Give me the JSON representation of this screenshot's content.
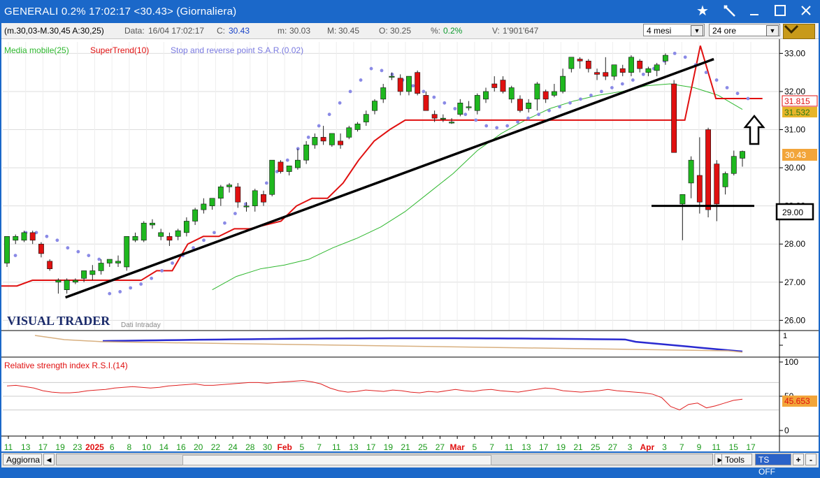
{
  "window": {
    "title": "GENERALI 0.2% 17:02:17  <30.43> (Giornaliera)",
    "star_icon": "star-icon",
    "pin_icon": "pin-icon",
    "minimize_icon": "minimize-icon",
    "maximize_icon": "maximize-icon",
    "close_icon": "close-icon"
  },
  "infobar": {
    "range": "(m.30,03-M.30,45 A:30,25)",
    "date_label": "Data:",
    "date_value": "16/04 17:02:17",
    "close_label": "C:",
    "close_value": "30.43",
    "min_label": "m:",
    "min_value": "30.03",
    "max_label": "M:",
    "max_value": "30.45",
    "open_label": "O:",
    "open_value": "30.25",
    "pct_label": "%:",
    "pct_value": "0.2%",
    "vol_label": "V:",
    "vol_value": "1'901'647",
    "period_select": "4 mesi",
    "interval_select": "24 ore"
  },
  "legend": {
    "ma": "Media mobile(25)",
    "supertrend": "SuperTrend(10)",
    "sar": "Stop and reverse point S.A.R.(0.02)"
  },
  "watermark": {
    "brand": "VISUAL TRADER",
    "subtitle": "Dati Intraday"
  },
  "rsi_panel": {
    "title": "Relative strength index R.S.I.(14)"
  },
  "osc_panel": {
    "top_label": "1"
  },
  "price_tags": {
    "sar_value": "31.815",
    "ma_value": "31.532",
    "last_value": "30.43",
    "level_value": "29.00",
    "rsi_value": "45.653"
  },
  "bottombar": {
    "update_button": "Aggiorna",
    "tools_button": "Tools",
    "ts_button": "TS OFF",
    "plus_button": "+",
    "minus_button": "-"
  },
  "colors": {
    "up_candle": "#1fb81f",
    "down_candle": "#e01010",
    "ma": "#2fb82f",
    "supertrend": "#e01010",
    "sar": "#8a8ae6",
    "rsi": "#e02020",
    "axis_dates_red": "#e01010",
    "axis_dates_green": "#1a9a1a"
  },
  "chart_data": {
    "type": "candlestick",
    "title": "GENERALI (Giornaliera)",
    "price_axis": {
      "ticks": [
        26.0,
        27.0,
        28.0,
        29.0,
        30.0,
        31.0,
        32.0,
        33.0
      ],
      "ylim": [
        25.75,
        33.3
      ]
    },
    "rsi_axis": {
      "ticks": [
        0,
        50,
        100
      ]
    },
    "x_labels": [
      "11",
      "13",
      "17",
      "19",
      "23",
      "2025",
      "6",
      "8",
      "10",
      "14",
      "16",
      "20",
      "22",
      "24",
      "28",
      "30",
      "Feb",
      "5",
      "7",
      "11",
      "13",
      "17",
      "19",
      "21",
      "25",
      "27",
      "Mar",
      "5",
      "7",
      "11",
      "13",
      "17",
      "19",
      "21",
      "25",
      "27",
      "3",
      "Apr",
      "3",
      "7",
      "9",
      "11",
      "15",
      "17"
    ],
    "candles": [
      {
        "o": 27.5,
        "h": 28.2,
        "l": 27.4,
        "c": 28.2
      },
      {
        "o": 28.1,
        "h": 28.25,
        "l": 28.0,
        "c": 28.2
      },
      {
        "o": 28.1,
        "h": 28.35,
        "l": 28.05,
        "c": 28.3
      },
      {
        "o": 28.3,
        "h": 28.35,
        "l": 28.0,
        "c": 28.1
      },
      {
        "o": 28.0,
        "h": 28.05,
        "l": 27.65,
        "c": 27.75
      },
      {
        "o": 27.55,
        "h": 27.6,
        "l": 27.3,
        "c": 27.35
      },
      {
        "o": 27.0,
        "h": 27.1,
        "l": 26.7,
        "c": 27.05
      },
      {
        "o": 26.8,
        "h": 27.1,
        "l": 26.7,
        "c": 27.05
      },
      {
        "o": 27.0,
        "h": 27.1,
        "l": 26.95,
        "c": 27.05
      },
      {
        "o": 27.1,
        "h": 27.3,
        "l": 27.0,
        "c": 27.3
      },
      {
        "o": 27.2,
        "h": 27.45,
        "l": 27.05,
        "c": 27.3
      },
      {
        "o": 27.3,
        "h": 27.6,
        "l": 27.2,
        "c": 27.5
      },
      {
        "o": 27.5,
        "h": 27.6,
        "l": 27.4,
        "c": 27.6
      },
      {
        "o": 27.5,
        "h": 27.7,
        "l": 27.4,
        "c": 27.55
      },
      {
        "o": 27.4,
        "h": 28.2,
        "l": 27.3,
        "c": 28.2
      },
      {
        "o": 28.1,
        "h": 28.3,
        "l": 28.05,
        "c": 28.2
      },
      {
        "o": 28.1,
        "h": 28.6,
        "l": 28.05,
        "c": 28.55
      },
      {
        "o": 28.5,
        "h": 28.65,
        "l": 28.4,
        "c": 28.55
      },
      {
        "o": 28.2,
        "h": 28.4,
        "l": 28.1,
        "c": 28.3
      },
      {
        "o": 28.2,
        "h": 28.3,
        "l": 27.95,
        "c": 28.1
      },
      {
        "o": 28.2,
        "h": 28.4,
        "l": 28.1,
        "c": 28.35
      },
      {
        "o": 28.3,
        "h": 28.7,
        "l": 28.2,
        "c": 28.6
      },
      {
        "o": 28.6,
        "h": 28.95,
        "l": 28.5,
        "c": 28.9
      },
      {
        "o": 28.9,
        "h": 29.2,
        "l": 28.8,
        "c": 29.05
      },
      {
        "o": 29.0,
        "h": 29.2,
        "l": 28.9,
        "c": 29.2
      },
      {
        "o": 29.2,
        "h": 29.55,
        "l": 29.0,
        "c": 29.5
      },
      {
        "o": 29.5,
        "h": 29.6,
        "l": 29.35,
        "c": 29.55
      },
      {
        "o": 29.5,
        "h": 29.6,
        "l": 28.95,
        "c": 29.1
      },
      {
        "o": 29.0,
        "h": 29.1,
        "l": 28.85,
        "c": 29.0
      },
      {
        "o": 29.0,
        "h": 29.45,
        "l": 28.85,
        "c": 29.4
      },
      {
        "o": 29.3,
        "h": 29.4,
        "l": 29.0,
        "c": 29.1
      },
      {
        "o": 29.3,
        "h": 30.2,
        "l": 29.25,
        "c": 30.2
      },
      {
        "o": 30.15,
        "h": 30.2,
        "l": 29.85,
        "c": 29.9
      },
      {
        "o": 29.9,
        "h": 30.05,
        "l": 29.8,
        "c": 30.05
      },
      {
        "o": 30.0,
        "h": 30.5,
        "l": 29.95,
        "c": 30.2
      },
      {
        "o": 30.2,
        "h": 30.7,
        "l": 30.1,
        "c": 30.6
      },
      {
        "o": 30.6,
        "h": 30.9,
        "l": 30.5,
        "c": 30.8
      },
      {
        "o": 30.8,
        "h": 31.1,
        "l": 30.6,
        "c": 30.7
      },
      {
        "o": 30.6,
        "h": 30.9,
        "l": 30.55,
        "c": 30.9
      },
      {
        "o": 30.7,
        "h": 30.9,
        "l": 30.5,
        "c": 30.6
      },
      {
        "o": 30.8,
        "h": 31.1,
        "l": 30.75,
        "c": 31.05
      },
      {
        "o": 31.0,
        "h": 31.2,
        "l": 30.95,
        "c": 31.15
      },
      {
        "o": 31.2,
        "h": 31.5,
        "l": 31.1,
        "c": 31.4
      },
      {
        "o": 31.5,
        "h": 31.8,
        "l": 31.4,
        "c": 31.75
      },
      {
        "o": 31.8,
        "h": 32.2,
        "l": 31.7,
        "c": 32.1
      },
      {
        "o": 32.4,
        "h": 32.5,
        "l": 32.3,
        "c": 32.4
      },
      {
        "o": 32.35,
        "h": 32.45,
        "l": 31.9,
        "c": 32.0
      },
      {
        "o": 32.0,
        "h": 32.4,
        "l": 31.9,
        "c": 32.4
      },
      {
        "o": 32.5,
        "h": 32.55,
        "l": 31.9,
        "c": 31.95
      },
      {
        "o": 31.9,
        "h": 32.0,
        "l": 31.5,
        "c": 31.5
      },
      {
        "o": 31.4,
        "h": 31.5,
        "l": 31.2,
        "c": 31.3
      },
      {
        "o": 31.3,
        "h": 31.4,
        "l": 31.2,
        "c": 31.3
      },
      {
        "o": 31.2,
        "h": 31.3,
        "l": 31.15,
        "c": 31.2
      },
      {
        "o": 31.4,
        "h": 31.8,
        "l": 31.35,
        "c": 31.7
      },
      {
        "o": 31.6,
        "h": 31.75,
        "l": 31.5,
        "c": 31.6
      },
      {
        "o": 31.5,
        "h": 31.95,
        "l": 31.4,
        "c": 31.9
      },
      {
        "o": 31.8,
        "h": 32.1,
        "l": 31.7,
        "c": 32.0
      },
      {
        "o": 32.2,
        "h": 32.4,
        "l": 32.0,
        "c": 32.1
      },
      {
        "o": 32.3,
        "h": 32.4,
        "l": 31.95,
        "c": 32.0
      },
      {
        "o": 31.8,
        "h": 32.15,
        "l": 31.7,
        "c": 32.1
      },
      {
        "o": 31.8,
        "h": 31.9,
        "l": 31.45,
        "c": 31.5
      },
      {
        "o": 31.55,
        "h": 31.8,
        "l": 31.45,
        "c": 31.7
      },
      {
        "o": 31.8,
        "h": 32.25,
        "l": 31.5,
        "c": 32.2
      },
      {
        "o": 32.0,
        "h": 32.05,
        "l": 31.7,
        "c": 31.8
      },
      {
        "o": 31.9,
        "h": 32.2,
        "l": 31.85,
        "c": 32.0
      },
      {
        "o": 32.0,
        "h": 32.6,
        "l": 31.95,
        "c": 32.4
      },
      {
        "o": 32.6,
        "h": 32.9,
        "l": 32.5,
        "c": 32.9
      },
      {
        "o": 32.85,
        "h": 32.9,
        "l": 32.6,
        "c": 32.8
      },
      {
        "o": 32.8,
        "h": 32.85,
        "l": 32.5,
        "c": 32.6
      },
      {
        "o": 32.5,
        "h": 32.6,
        "l": 32.3,
        "c": 32.45
      },
      {
        "o": 32.5,
        "h": 32.9,
        "l": 32.3,
        "c": 32.4
      },
      {
        "o": 32.4,
        "h": 32.7,
        "l": 32.3,
        "c": 32.7
      },
      {
        "o": 32.6,
        "h": 32.7,
        "l": 32.4,
        "c": 32.5
      },
      {
        "o": 32.5,
        "h": 32.95,
        "l": 32.4,
        "c": 32.9
      },
      {
        "o": 32.8,
        "h": 32.85,
        "l": 32.5,
        "c": 32.6
      },
      {
        "o": 32.5,
        "h": 32.65,
        "l": 32.4,
        "c": 32.6
      },
      {
        "o": 32.55,
        "h": 32.75,
        "l": 32.4,
        "c": 32.7
      },
      {
        "o": 32.8,
        "h": 33.0,
        "l": 32.7,
        "c": 32.95
      },
      {
        "o": 32.2,
        "h": 32.3,
        "l": 30.4,
        "c": 30.4
      },
      {
        "o": 29.05,
        "h": 29.3,
        "l": 28.1,
        "c": 29.3
      },
      {
        "o": 29.6,
        "h": 30.3,
        "l": 29.2,
        "c": 30.2
      },
      {
        "o": 29.8,
        "h": 30.8,
        "l": 28.8,
        "c": 29.1
      },
      {
        "o": 31.0,
        "h": 31.05,
        "l": 28.7,
        "c": 28.9
      },
      {
        "o": 30.1,
        "h": 30.2,
        "l": 28.6,
        "c": 29.05
      },
      {
        "o": 29.5,
        "h": 29.9,
        "l": 29.3,
        "c": 29.85
      },
      {
        "o": 29.85,
        "h": 30.45,
        "l": 29.8,
        "c": 30.3
      },
      {
        "o": 30.25,
        "h": 30.45,
        "l": 30.03,
        "c": 30.43
      }
    ],
    "sma25": [
      26.8,
      27.15,
      27.35,
      27.45,
      27.6,
      27.9,
      28.15,
      28.45,
      28.85,
      29.35,
      29.85,
      30.45,
      30.9,
      31.25,
      31.55,
      31.75,
      31.9,
      32.0,
      32.15,
      32.2,
      32.1,
      31.9,
      31.53
    ],
    "supertrend": [
      26.9,
      26.9,
      27.05,
      27.05,
      27.05,
      27.05,
      27.05,
      27.05,
      27.05,
      27.05,
      27.3,
      27.3,
      28.0,
      28.2,
      28.2,
      28.4,
      28.4,
      28.5,
      28.6,
      29.0,
      29.2,
      29.2,
      29.6,
      30.2,
      30.7,
      31.0,
      31.25,
      31.25,
      31.25,
      31.25,
      31.25,
      31.25,
      31.25,
      31.25,
      31.25,
      31.25,
      31.25,
      31.25,
      31.25,
      31.25,
      31.25,
      31.25,
      31.25,
      31.25,
      31.25,
      33.2,
      31.815,
      31.815,
      31.815,
      31.815
    ],
    "sar_points_note": "",
    "sar": [
      27.7,
      28.3,
      28.3,
      28.2,
      28.1,
      27.9,
      27.8,
      27.7,
      27.6,
      26.7,
      26.75,
      26.85,
      26.95,
      27.1,
      27.3,
      27.5,
      27.7,
      27.9,
      28.1,
      28.3,
      28.55,
      28.8,
      29.05,
      29.3,
      29.6,
      29.9,
      30.2,
      30.5,
      30.8,
      31.1,
      31.4,
      31.7,
      32.0,
      32.3,
      32.6,
      32.55,
      32.45,
      32.3,
      32.15,
      32.0,
      31.85,
      31.7,
      31.55,
      31.4,
      31.25,
      31.1,
      31.05,
      31.1,
      31.2,
      31.3,
      31.4,
      31.5,
      31.6,
      31.7,
      31.8,
      31.9,
      32.0,
      32.1,
      32.2,
      32.3,
      32.45,
      32.6,
      32.8,
      33.0,
      32.9,
      32.7,
      32.5,
      32.3,
      32.1,
      31.95,
      31.815
    ],
    "trendline": [
      {
        "i": 7,
        "v": 26.6
      },
      {
        "i": 82,
        "v": 32.85
      }
    ],
    "support_line": 29.0,
    "rsi": [
      65,
      66,
      64,
      62,
      58,
      56,
      55,
      55,
      56,
      58,
      59,
      60,
      62,
      63,
      64,
      63,
      62,
      63,
      65,
      66,
      67,
      68,
      66,
      66,
      67,
      68,
      69,
      70,
      70,
      69,
      70,
      71,
      72,
      73,
      71,
      68,
      62,
      58,
      56,
      57,
      59,
      58,
      57,
      59,
      58,
      56,
      55,
      57,
      56,
      58,
      60,
      58,
      57,
      59,
      60,
      58,
      57,
      56,
      58,
      60,
      62,
      61,
      58,
      57,
      56,
      57,
      58,
      60,
      58,
      57,
      56,
      55,
      53,
      48,
      35,
      30,
      38,
      40,
      33,
      36,
      40,
      44,
      45.65
    ],
    "rsi_levels": [
      30,
      50,
      70
    ],
    "osc_series_note": ""
  }
}
